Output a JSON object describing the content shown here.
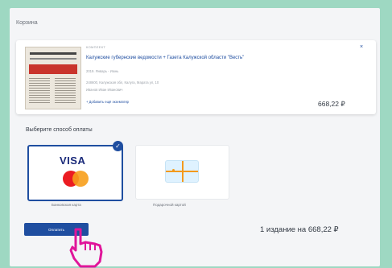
{
  "cart": {
    "label": "Корзина",
    "item": {
      "kind": "КОМПЛЕКТ",
      "title": "Калужские губернские ведомости + Газета Калужской области \"Весть\"",
      "date": "2019. Январь - Июнь",
      "address": "248600, Калужская обл, Калуга, Марата ул, 10",
      "recipient": "Иванов Иван Иванович",
      "add_copy": "+ Добавить ещё экземпляр",
      "close": "×",
      "price": "668,22 ₽"
    }
  },
  "payment": {
    "title": "Выберите способ оплаты",
    "options": [
      {
        "label": "Банковская карта",
        "selected": true,
        "icons": [
          "visa-logo",
          "mastercard-logo"
        ]
      },
      {
        "label": "Подарочной картой",
        "selected": false,
        "icons": [
          "gift-card-icon"
        ]
      }
    ],
    "visa_text": "VISA",
    "check_mark": "✓"
  },
  "footer": {
    "pay_button": "Оплатить",
    "summary": "1 издание на 668,22 ₽"
  },
  "colors": {
    "background": "#9ed8c2",
    "accent": "#1f4ea0",
    "cursor": "#e0159a"
  }
}
